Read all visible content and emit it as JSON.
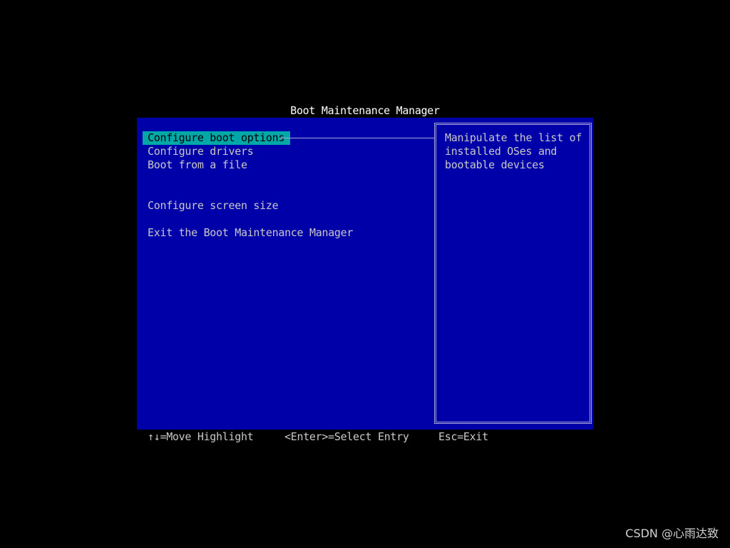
{
  "title": "Boot Maintenance Manager",
  "menu": {
    "items": [
      {
        "label": "Configure boot options",
        "selected": true
      },
      {
        "label": "Configure drivers",
        "selected": false
      },
      {
        "label": "Boot from a file",
        "selected": false
      },
      {
        "label": "Configure screen size",
        "selected": false
      },
      {
        "label": "Exit the Boot Maintenance Manager",
        "selected": false
      }
    ]
  },
  "help": {
    "lines": [
      "Manipulate the list of",
      "installed OSes and",
      "bootable devices"
    ]
  },
  "footer": {
    "move": "↑↓=Move Highlight",
    "select": "<Enter>=Select Entry",
    "exit": "Esc=Exit"
  },
  "watermark": "CSDN @心雨达致",
  "colors": {
    "background": "#000000",
    "panel": "#0000a8",
    "highlight": "#00a8a8",
    "text": "#c8c8c8",
    "title": "#ffffff"
  }
}
